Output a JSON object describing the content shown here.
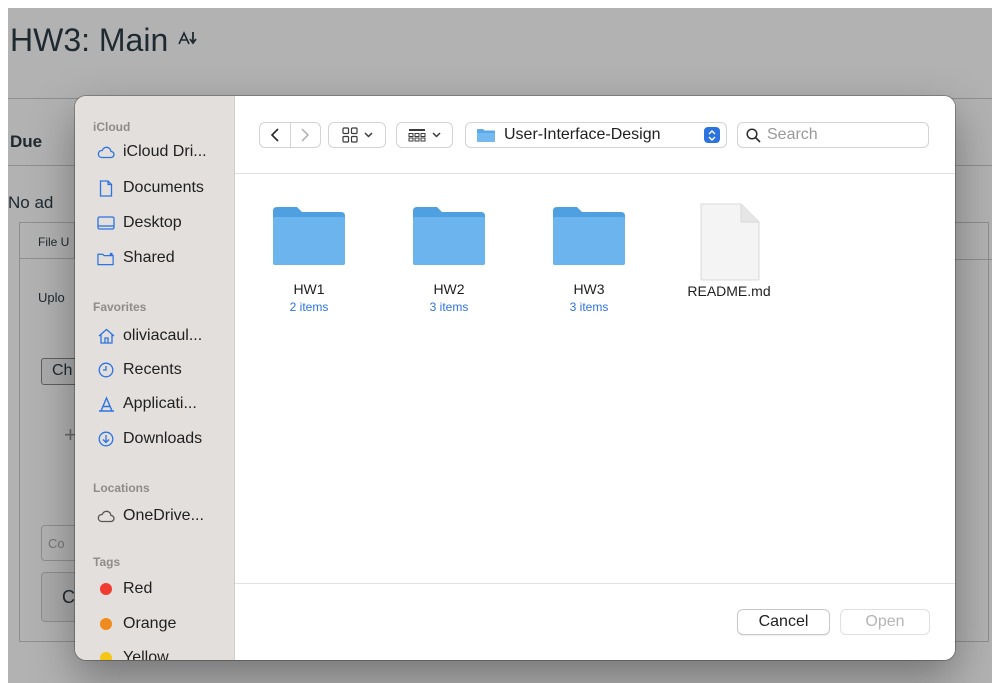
{
  "background": {
    "title": "HW3: Main",
    "sort_icon": "sort-icon",
    "due_label": "Due",
    "no_add_text": "No ad",
    "tab_label": "File U",
    "upload_text": "Uplo",
    "choose_button": "Ch",
    "comment_placeholder": "Co",
    "cancel_fragment": "C"
  },
  "sidebar": {
    "sections": [
      {
        "header": "iCloud",
        "items": [
          {
            "label": "iCloud Dri...",
            "icon": "cloud-icon"
          },
          {
            "label": "Documents",
            "icon": "document-icon"
          },
          {
            "label": "Desktop",
            "icon": "desktop-icon"
          },
          {
            "label": "Shared",
            "icon": "shared-folder-icon"
          }
        ]
      },
      {
        "header": "Favorites",
        "items": [
          {
            "label": "oliviacaul...",
            "icon": "home-icon"
          },
          {
            "label": "Recents",
            "icon": "clock-icon"
          },
          {
            "label": "Applicati...",
            "icon": "applications-icon"
          },
          {
            "label": "Downloads",
            "icon": "download-icon"
          }
        ]
      },
      {
        "header": "Locations",
        "items": [
          {
            "label": "OneDrive...",
            "icon": "cloud-icon"
          }
        ]
      },
      {
        "header": "Tags",
        "items": [
          {
            "label": "Red",
            "color": "#f03c2e"
          },
          {
            "label": "Orange",
            "color": "#f08a1c"
          },
          {
            "label": "Yellow",
            "color": "#f5c518"
          }
        ]
      }
    ]
  },
  "toolbar": {
    "current_folder": "User-Interface-Design",
    "search_placeholder": "Search"
  },
  "files": [
    {
      "name": "HW1",
      "count": "2 items",
      "type": "folder"
    },
    {
      "name": "HW2",
      "count": "3 items",
      "type": "folder"
    },
    {
      "name": "HW3",
      "count": "3 items",
      "type": "folder"
    },
    {
      "name": "README.md",
      "count": "",
      "type": "document"
    }
  ],
  "footer": {
    "cancel_label": "Cancel",
    "open_label": "Open"
  },
  "colors": {
    "accent": "#2c73e0",
    "folder": "#6cb4ee",
    "sidebar_bg": "#e3dfdd"
  }
}
